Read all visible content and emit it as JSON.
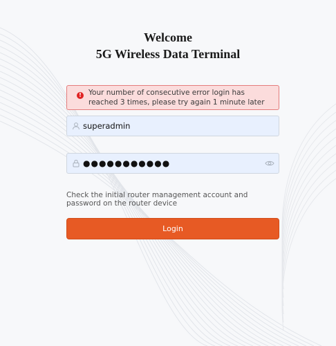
{
  "header": {
    "title_line1": "Welcome",
    "title_line2": "5G Wireless Data Terminal"
  },
  "alert": {
    "icon": "error-icon",
    "glyph": "!",
    "message": "Your number of consecutive error login has reached 3 times, please try again 1 minute later",
    "color": "#e02424"
  },
  "form": {
    "username": {
      "icon": "user-icon",
      "value": "superadmin"
    },
    "password": {
      "icon": "lock-icon",
      "masked_value": "●●●●●●●●●●●",
      "toggle_icon": "eye-icon"
    },
    "hint": "Check the initial router management account and password on the router device",
    "login_label": "Login"
  },
  "colors": {
    "accent": "#e75a24",
    "field_bg": "#e8f0fe",
    "page_bg": "#f7f8fa"
  }
}
